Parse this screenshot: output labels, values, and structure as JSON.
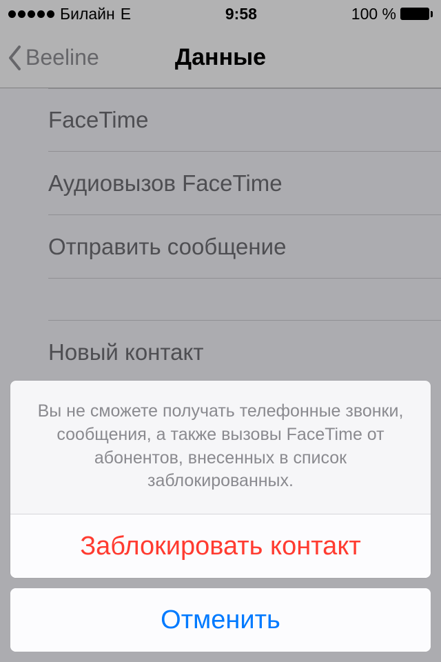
{
  "status": {
    "carrier": "Билайн",
    "network": "E",
    "time": "9:58",
    "battery_pct": "100 %"
  },
  "nav": {
    "back_label": "Beeline",
    "title": "Данные"
  },
  "rows": {
    "facetime": "FaceTime",
    "facetime_audio": "Аудиовызов FaceTime",
    "send_message": "Отправить сообщение",
    "new_contact": "Новый контакт"
  },
  "sheet": {
    "message": "Вы не сможете получать телефонные звонки, сообщения, а также вызовы FaceTime от абонентов, внесенных в список заблокированных.",
    "block_label": "Заблокировать контакт",
    "cancel_label": "Отменить"
  }
}
